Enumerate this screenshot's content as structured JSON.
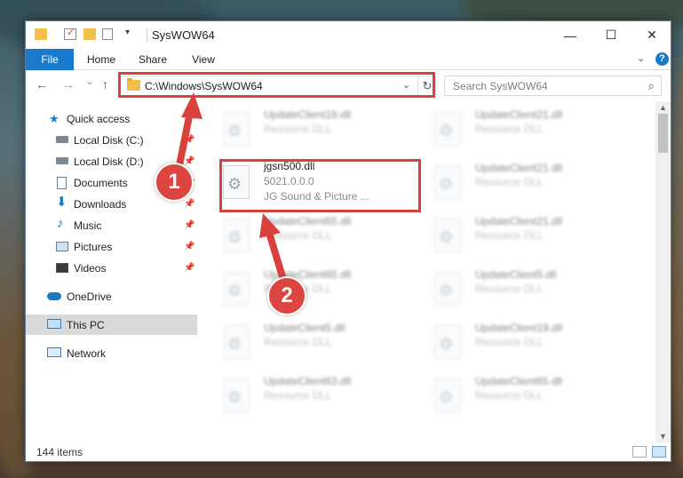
{
  "window": {
    "title": "SysWOW64",
    "minimize_glyph": "—",
    "maximize_glyph": "☐",
    "close_glyph": "✕"
  },
  "ribbon": {
    "tabs": [
      "File",
      "Home",
      "Share",
      "View"
    ]
  },
  "nav": {
    "back_glyph": "←",
    "forward_glyph": "→",
    "recent_glyph": "⌄",
    "up_glyph": "↑",
    "address": "C:\\Windows\\SysWOW64",
    "refresh_glyph": "↻",
    "search_placeholder": "Search SysWOW64"
  },
  "sidebar": {
    "items": [
      {
        "label": "Quick access",
        "icon": "star-icon",
        "pinned": false
      },
      {
        "label": "Local Disk (C:)",
        "icon": "drive-icon",
        "pinned": true
      },
      {
        "label": "Local Disk (D:)",
        "icon": "drive-icon",
        "pinned": true
      },
      {
        "label": "Documents",
        "icon": "documents-icon",
        "pinned": true
      },
      {
        "label": "Downloads",
        "icon": "downloads-icon",
        "pinned": true
      },
      {
        "label": "Music",
        "icon": "music-icon",
        "pinned": true
      },
      {
        "label": "Pictures",
        "icon": "pictures-icon",
        "pinned": true
      },
      {
        "label": "Videos",
        "icon": "videos-icon",
        "pinned": true
      },
      {
        "label": "OneDrive",
        "icon": "onedrive-icon",
        "pinned": false
      },
      {
        "label": "This PC",
        "icon": "this-pc-icon",
        "pinned": false,
        "selected": true
      },
      {
        "label": "Network",
        "icon": "network-icon",
        "pinned": false
      }
    ]
  },
  "files": [
    {
      "name": "UpdateClient19.dll",
      "line2": "Resource DLL",
      "line3": "",
      "highlight": false
    },
    {
      "name": "UpdateClient21.dll",
      "line2": "Resource DLL",
      "line3": "",
      "highlight": false
    },
    {
      "name": "jgsn500.dll",
      "line2": "5021.0.0.0",
      "line3": "JG Sound & Picture ...",
      "highlight": true
    },
    {
      "name": "UpdateClient21.dll",
      "line2": "Resource DLL",
      "line3": "",
      "highlight": false
    },
    {
      "name": "UpdateClient65.dll",
      "line2": "Resource DLL",
      "line3": "",
      "highlight": false
    },
    {
      "name": "UpdateClient21.dll",
      "line2": "Resource DLL",
      "line3": "",
      "highlight": false
    },
    {
      "name": "UpdateClient65.dll",
      "line2": "Resource DLL",
      "line3": "",
      "highlight": false
    },
    {
      "name": "UpdateClient5.dll",
      "line2": "Resource DLL",
      "line3": "",
      "highlight": false
    },
    {
      "name": "UpdateClient5.dll",
      "line2": "Resource DLL",
      "line3": "",
      "highlight": false
    },
    {
      "name": "UpdateClient19.dll",
      "line2": "Resource DLL",
      "line3": "",
      "highlight": false
    },
    {
      "name": "UpdateClient63.dll",
      "line2": "Resource DLL",
      "line3": "",
      "highlight": false
    },
    {
      "name": "UpdateClient65.dll",
      "line2": "Resource DLL",
      "line3": "",
      "highlight": false
    }
  ],
  "status": {
    "item_count": "144 items"
  },
  "annotations": {
    "badge1": "1",
    "badge2": "2",
    "accent": "#d9413d"
  },
  "colors": {
    "file_tab": "#1979ca",
    "selected_nav": "#d9d9d9"
  }
}
